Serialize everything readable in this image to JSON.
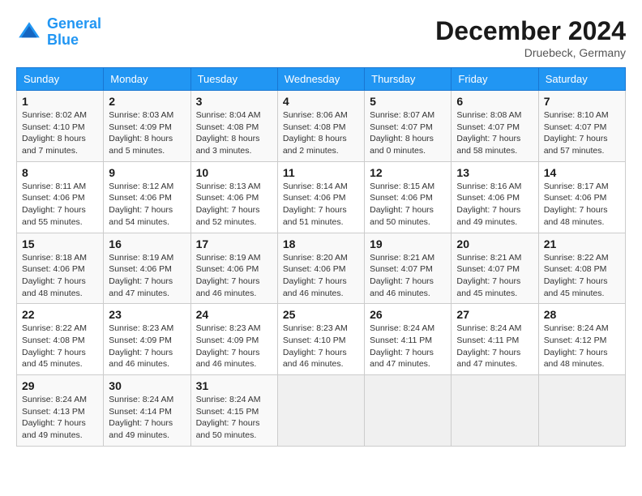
{
  "header": {
    "logo_line1": "General",
    "logo_line2": "Blue",
    "month": "December 2024",
    "location": "Druebeck, Germany"
  },
  "days_of_week": [
    "Sunday",
    "Monday",
    "Tuesday",
    "Wednesday",
    "Thursday",
    "Friday",
    "Saturday"
  ],
  "weeks": [
    [
      {
        "day": 1,
        "info": "Sunrise: 8:02 AM\nSunset: 4:10 PM\nDaylight: 8 hours\nand 7 minutes."
      },
      {
        "day": 2,
        "info": "Sunrise: 8:03 AM\nSunset: 4:09 PM\nDaylight: 8 hours\nand 5 minutes."
      },
      {
        "day": 3,
        "info": "Sunrise: 8:04 AM\nSunset: 4:08 PM\nDaylight: 8 hours\nand 3 minutes."
      },
      {
        "day": 4,
        "info": "Sunrise: 8:06 AM\nSunset: 4:08 PM\nDaylight: 8 hours\nand 2 minutes."
      },
      {
        "day": 5,
        "info": "Sunrise: 8:07 AM\nSunset: 4:07 PM\nDaylight: 8 hours\nand 0 minutes."
      },
      {
        "day": 6,
        "info": "Sunrise: 8:08 AM\nSunset: 4:07 PM\nDaylight: 7 hours\nand 58 minutes."
      },
      {
        "day": 7,
        "info": "Sunrise: 8:10 AM\nSunset: 4:07 PM\nDaylight: 7 hours\nand 57 minutes."
      }
    ],
    [
      {
        "day": 8,
        "info": "Sunrise: 8:11 AM\nSunset: 4:06 PM\nDaylight: 7 hours\nand 55 minutes."
      },
      {
        "day": 9,
        "info": "Sunrise: 8:12 AM\nSunset: 4:06 PM\nDaylight: 7 hours\nand 54 minutes."
      },
      {
        "day": 10,
        "info": "Sunrise: 8:13 AM\nSunset: 4:06 PM\nDaylight: 7 hours\nand 52 minutes."
      },
      {
        "day": 11,
        "info": "Sunrise: 8:14 AM\nSunset: 4:06 PM\nDaylight: 7 hours\nand 51 minutes."
      },
      {
        "day": 12,
        "info": "Sunrise: 8:15 AM\nSunset: 4:06 PM\nDaylight: 7 hours\nand 50 minutes."
      },
      {
        "day": 13,
        "info": "Sunrise: 8:16 AM\nSunset: 4:06 PM\nDaylight: 7 hours\nand 49 minutes."
      },
      {
        "day": 14,
        "info": "Sunrise: 8:17 AM\nSunset: 4:06 PM\nDaylight: 7 hours\nand 48 minutes."
      }
    ],
    [
      {
        "day": 15,
        "info": "Sunrise: 8:18 AM\nSunset: 4:06 PM\nDaylight: 7 hours\nand 48 minutes."
      },
      {
        "day": 16,
        "info": "Sunrise: 8:19 AM\nSunset: 4:06 PM\nDaylight: 7 hours\nand 47 minutes."
      },
      {
        "day": 17,
        "info": "Sunrise: 8:19 AM\nSunset: 4:06 PM\nDaylight: 7 hours\nand 46 minutes."
      },
      {
        "day": 18,
        "info": "Sunrise: 8:20 AM\nSunset: 4:06 PM\nDaylight: 7 hours\nand 46 minutes."
      },
      {
        "day": 19,
        "info": "Sunrise: 8:21 AM\nSunset: 4:07 PM\nDaylight: 7 hours\nand 46 minutes."
      },
      {
        "day": 20,
        "info": "Sunrise: 8:21 AM\nSunset: 4:07 PM\nDaylight: 7 hours\nand 45 minutes."
      },
      {
        "day": 21,
        "info": "Sunrise: 8:22 AM\nSunset: 4:08 PM\nDaylight: 7 hours\nand 45 minutes."
      }
    ],
    [
      {
        "day": 22,
        "info": "Sunrise: 8:22 AM\nSunset: 4:08 PM\nDaylight: 7 hours\nand 45 minutes."
      },
      {
        "day": 23,
        "info": "Sunrise: 8:23 AM\nSunset: 4:09 PM\nDaylight: 7 hours\nand 46 minutes."
      },
      {
        "day": 24,
        "info": "Sunrise: 8:23 AM\nSunset: 4:09 PM\nDaylight: 7 hours\nand 46 minutes."
      },
      {
        "day": 25,
        "info": "Sunrise: 8:23 AM\nSunset: 4:10 PM\nDaylight: 7 hours\nand 46 minutes."
      },
      {
        "day": 26,
        "info": "Sunrise: 8:24 AM\nSunset: 4:11 PM\nDaylight: 7 hours\nand 47 minutes."
      },
      {
        "day": 27,
        "info": "Sunrise: 8:24 AM\nSunset: 4:11 PM\nDaylight: 7 hours\nand 47 minutes."
      },
      {
        "day": 28,
        "info": "Sunrise: 8:24 AM\nSunset: 4:12 PM\nDaylight: 7 hours\nand 48 minutes."
      }
    ],
    [
      {
        "day": 29,
        "info": "Sunrise: 8:24 AM\nSunset: 4:13 PM\nDaylight: 7 hours\nand 49 minutes."
      },
      {
        "day": 30,
        "info": "Sunrise: 8:24 AM\nSunset: 4:14 PM\nDaylight: 7 hours\nand 49 minutes."
      },
      {
        "day": 31,
        "info": "Sunrise: 8:24 AM\nSunset: 4:15 PM\nDaylight: 7 hours\nand 50 minutes."
      },
      null,
      null,
      null,
      null
    ]
  ]
}
